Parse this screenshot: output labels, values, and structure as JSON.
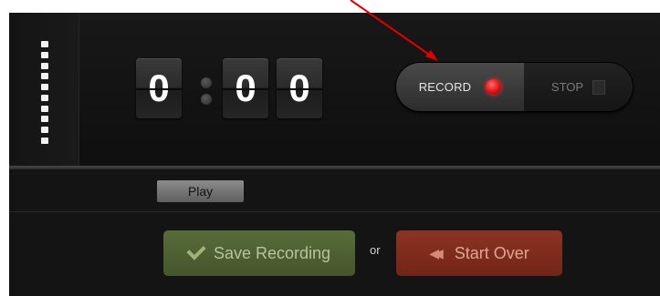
{
  "timer": {
    "minutes": "0",
    "seconds_tens": "0",
    "seconds_ones": "0"
  },
  "recorder": {
    "record_label": "RECORD",
    "stop_label": "STOP"
  },
  "playback": {
    "play_label": "Play"
  },
  "actions": {
    "save_label": "Save Recording",
    "or_label": "or",
    "start_over_label": "Start Over"
  },
  "icons": {
    "record": "record-dot-icon",
    "stop": "stop-square-icon",
    "save": "checkmark-icon",
    "start_over": "rewind-arrows-icon",
    "meter": "level-meter-icon"
  },
  "colors": {
    "record_dot": "#e10f0f",
    "save_button": "#4e6133",
    "start_over_button": "#7f2b1c",
    "annotation_arrow": "#e00000"
  }
}
